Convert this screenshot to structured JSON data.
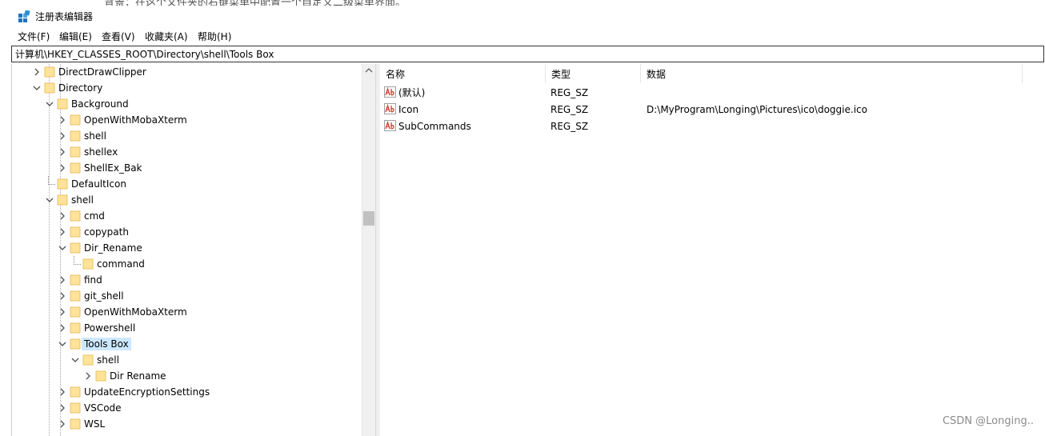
{
  "window": {
    "title": "注册表编辑器"
  },
  "menu": [
    "文件(F)",
    "编辑(E)",
    "查看(V)",
    "收藏夹(A)",
    "帮助(H)"
  ],
  "address": "计算机\\HKEY_CLASSES_ROOT\\Directory\\shell\\Tools Box",
  "tree": [
    {
      "label": "DirectDrawClipper",
      "level": 0,
      "state": "collapsed",
      "selected": false
    },
    {
      "label": "Directory",
      "level": 0,
      "state": "expanded",
      "selected": false
    },
    {
      "label": "Background",
      "level": 1,
      "state": "expanded",
      "selected": false
    },
    {
      "label": "OpenWithMobaXterm",
      "level": 2,
      "state": "collapsed",
      "selected": false
    },
    {
      "label": "shell",
      "level": 2,
      "state": "collapsed",
      "selected": false
    },
    {
      "label": "shellex",
      "level": 2,
      "state": "collapsed",
      "selected": false
    },
    {
      "label": "ShellEx_Bak",
      "level": 2,
      "state": "collapsed",
      "selected": false
    },
    {
      "label": "DefaultIcon",
      "level": 1,
      "state": "leaf",
      "selected": false
    },
    {
      "label": "shell",
      "level": 1,
      "state": "expanded",
      "selected": false
    },
    {
      "label": "cmd",
      "level": 2,
      "state": "collapsed",
      "selected": false
    },
    {
      "label": "copypath",
      "level": 2,
      "state": "collapsed",
      "selected": false
    },
    {
      "label": "Dir_Rename",
      "level": 2,
      "state": "expanded",
      "selected": false
    },
    {
      "label": "command",
      "level": 3,
      "state": "leaf",
      "selected": false
    },
    {
      "label": "find",
      "level": 2,
      "state": "collapsed",
      "selected": false
    },
    {
      "label": "git_shell",
      "level": 2,
      "state": "collapsed",
      "selected": false
    },
    {
      "label": "OpenWithMobaXterm",
      "level": 2,
      "state": "collapsed",
      "selected": false
    },
    {
      "label": "Powershell",
      "level": 2,
      "state": "collapsed",
      "selected": false
    },
    {
      "label": "Tools Box",
      "level": 2,
      "state": "expanded",
      "selected": true
    },
    {
      "label": "shell",
      "level": 3,
      "state": "expanded",
      "selected": false
    },
    {
      "label": "Dir Rename",
      "level": 4,
      "state": "collapsed",
      "selected": false
    },
    {
      "label": "UpdateEncryptionSettings",
      "level": 2,
      "state": "collapsed",
      "selected": false
    },
    {
      "label": "VSCode",
      "level": 2,
      "state": "collapsed",
      "selected": false
    },
    {
      "label": "WSL",
      "level": 2,
      "state": "collapsed",
      "selected": false
    }
  ],
  "columns": {
    "name": "名称",
    "type": "类型",
    "data": "数据"
  },
  "values": [
    {
      "name": "(默认)",
      "type": "REG_SZ",
      "data": ""
    },
    {
      "name": "Icon",
      "type": "REG_SZ",
      "data": "D:\\MyProgram\\Longing\\Pictures\\ico\\doggie.ico"
    },
    {
      "name": "SubCommands",
      "type": "REG_SZ",
      "data": ""
    }
  ],
  "icons": {
    "value": "string-value-icon",
    "folder": "folder-icon"
  },
  "watermark": "CSDN @Longing.."
}
